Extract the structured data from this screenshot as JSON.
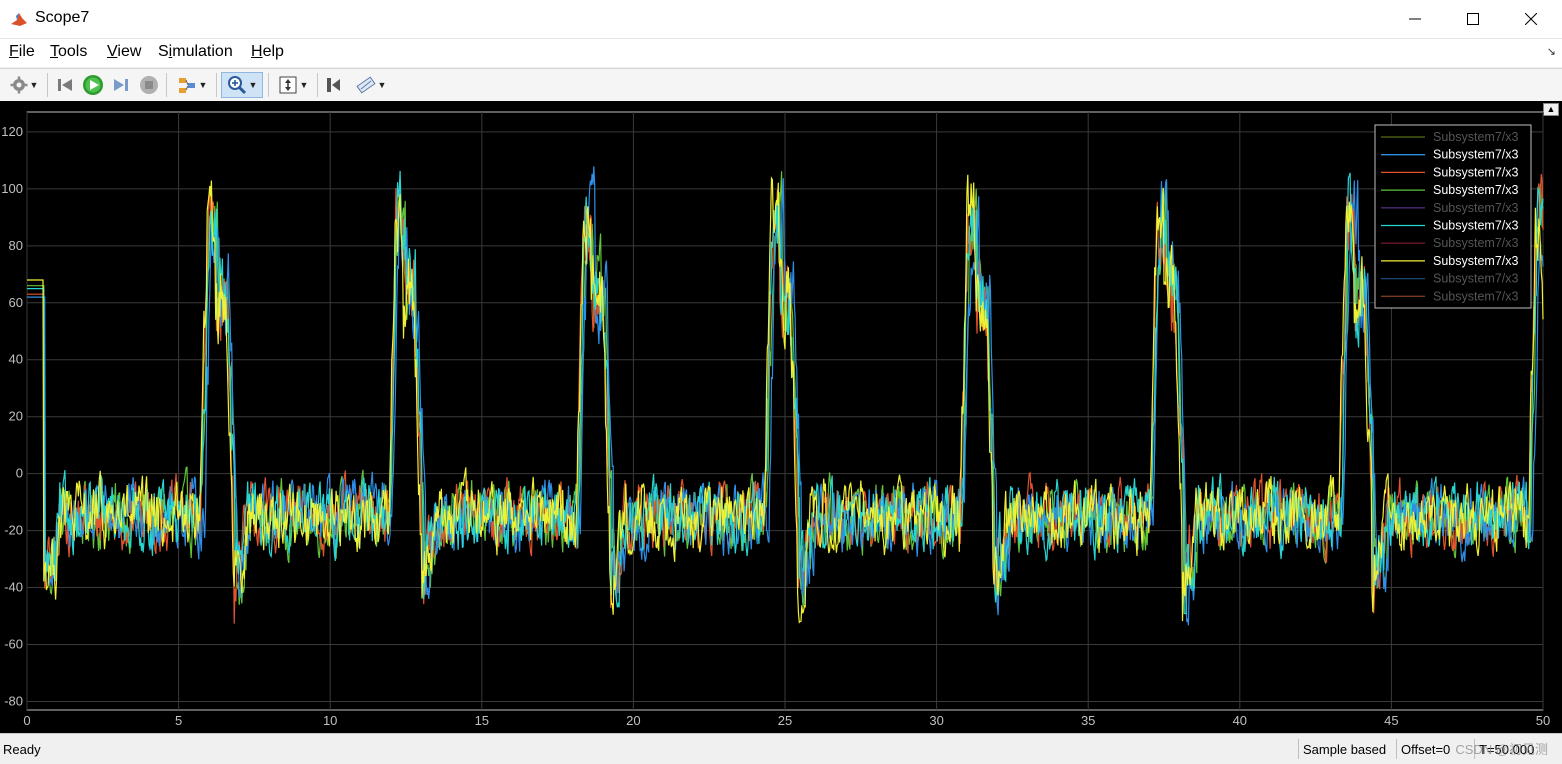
{
  "window": {
    "title": "Scope7",
    "controls": [
      "minimize-icon",
      "maximize-icon",
      "close-icon"
    ]
  },
  "menu": [
    {
      "label": "File",
      "hotkey_index": 0
    },
    {
      "label": "Tools",
      "hotkey_index": 0
    },
    {
      "label": "View",
      "hotkey_index": 0
    },
    {
      "label": "Simulation",
      "hotkey_index": 1
    },
    {
      "label": "Help",
      "hotkey_index": 0
    }
  ],
  "toolbar": {
    "icons": [
      "settings-gear-icon",
      "step-back-icon",
      "run-icon",
      "step-forward-icon",
      "stop-icon",
      "signal-highlight-icon",
      "zoom-in-icon",
      "autoscale-icon",
      "cursor-measure-icon",
      "measurement-tool-icon"
    ]
  },
  "status": {
    "ready": "Ready",
    "mode": "Sample based",
    "offset": "Offset=0",
    "time": "T=50.000",
    "watermark": "CSDN @初见测"
  },
  "colors": {
    "background": "#000000",
    "grid": "#3a3a3a",
    "axis_text": "#c0c0c0",
    "legend_bg": "#000000",
    "legend_border": "#c0c0c0"
  },
  "chart_data": {
    "type": "line",
    "xlim": [
      0,
      50
    ],
    "ylim": [
      -83,
      127
    ],
    "xticks": [
      0,
      5,
      10,
      15,
      20,
      25,
      30,
      35,
      40,
      45,
      50
    ],
    "yticks": [
      -80,
      -60,
      -40,
      -20,
      0,
      20,
      40,
      60,
      80,
      100,
      120
    ],
    "grid": true,
    "legend_position": "top-right",
    "legend": [
      {
        "name": "Subsystem7/x3",
        "color": "#5a6e1a",
        "dim": true
      },
      {
        "name": "Subsystem7/x3",
        "color": "#2f8fe6",
        "dim": false
      },
      {
        "name": "Subsystem7/x3",
        "color": "#e2522c",
        "dim": false
      },
      {
        "name": "Subsystem7/x3",
        "color": "#5fc43a",
        "dim": false
      },
      {
        "name": "Subsystem7/x3",
        "color": "#4c2c7a",
        "dim": true
      },
      {
        "name": "Subsystem7/x3",
        "color": "#27d6d2",
        "dim": false
      },
      {
        "name": "Subsystem7/x3",
        "color": "#6a1a2a",
        "dim": true
      },
      {
        "name": "Subsystem7/x3",
        "color": "#f0f034",
        "dim": false
      },
      {
        "name": "Subsystem7/x3",
        "color": "#1a4a7a",
        "dim": true
      },
      {
        "name": "Subsystem7/x3",
        "color": "#7a3a20",
        "dim": true
      }
    ],
    "visible_series": [
      {
        "color": "#5fc43a",
        "phase": 0.15,
        "init": 66
      },
      {
        "color": "#e2522c",
        "phase": 0.05,
        "init": 63
      },
      {
        "color": "#2f8fe6",
        "phase": 0.25,
        "init": 62
      },
      {
        "color": "#27d6d2",
        "phase": 0.1,
        "init": 65
      },
      {
        "color": "#f0f034",
        "phase": 0.0,
        "init": 68
      }
    ],
    "waveform": {
      "samples": 1800,
      "initial_until": 0.55,
      "period": 6.2,
      "pulse_start": 5.7,
      "pulse_width": 1.1,
      "pulse_peak": 88,
      "pulse_level": 62,
      "base_level": -15,
      "noise_amp": 9,
      "dip_level": -38
    }
  }
}
